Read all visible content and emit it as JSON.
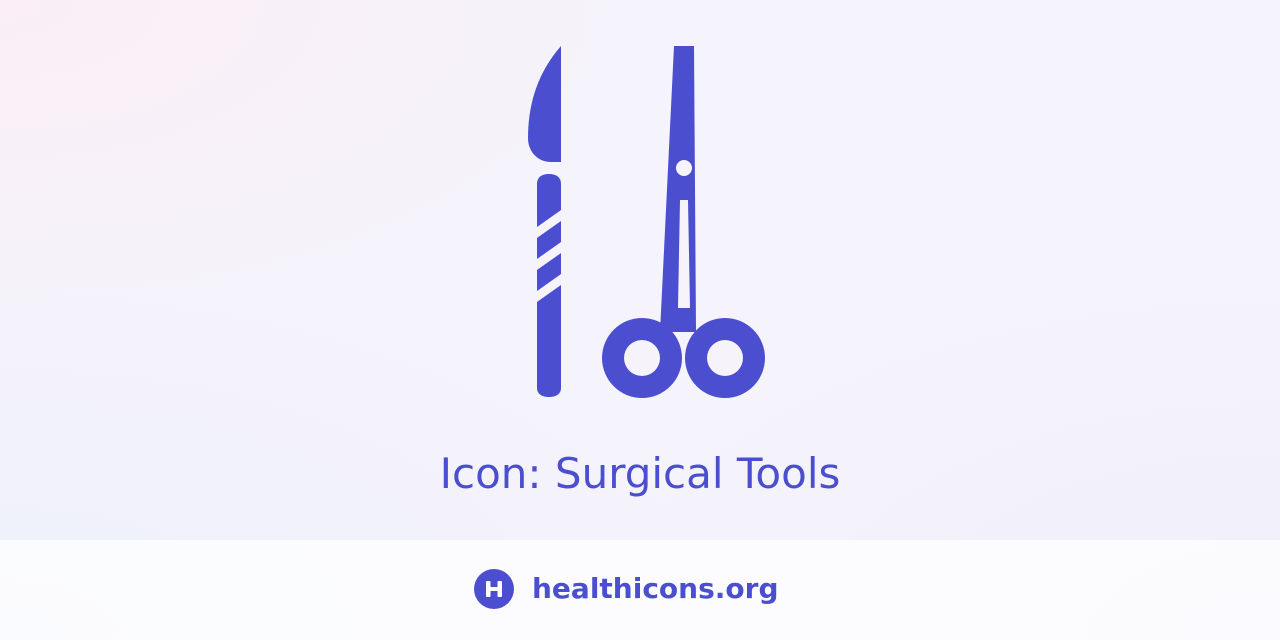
{
  "hero": {
    "icon_name": "surgical-tools-icon",
    "title": "Icon: Surgical Tools"
  },
  "footer": {
    "logo_icon": "healthicons-logo-icon",
    "site": "healthicons.org"
  },
  "colors": {
    "accent": "#4b4fcf",
    "background": "#f5f3fb"
  }
}
